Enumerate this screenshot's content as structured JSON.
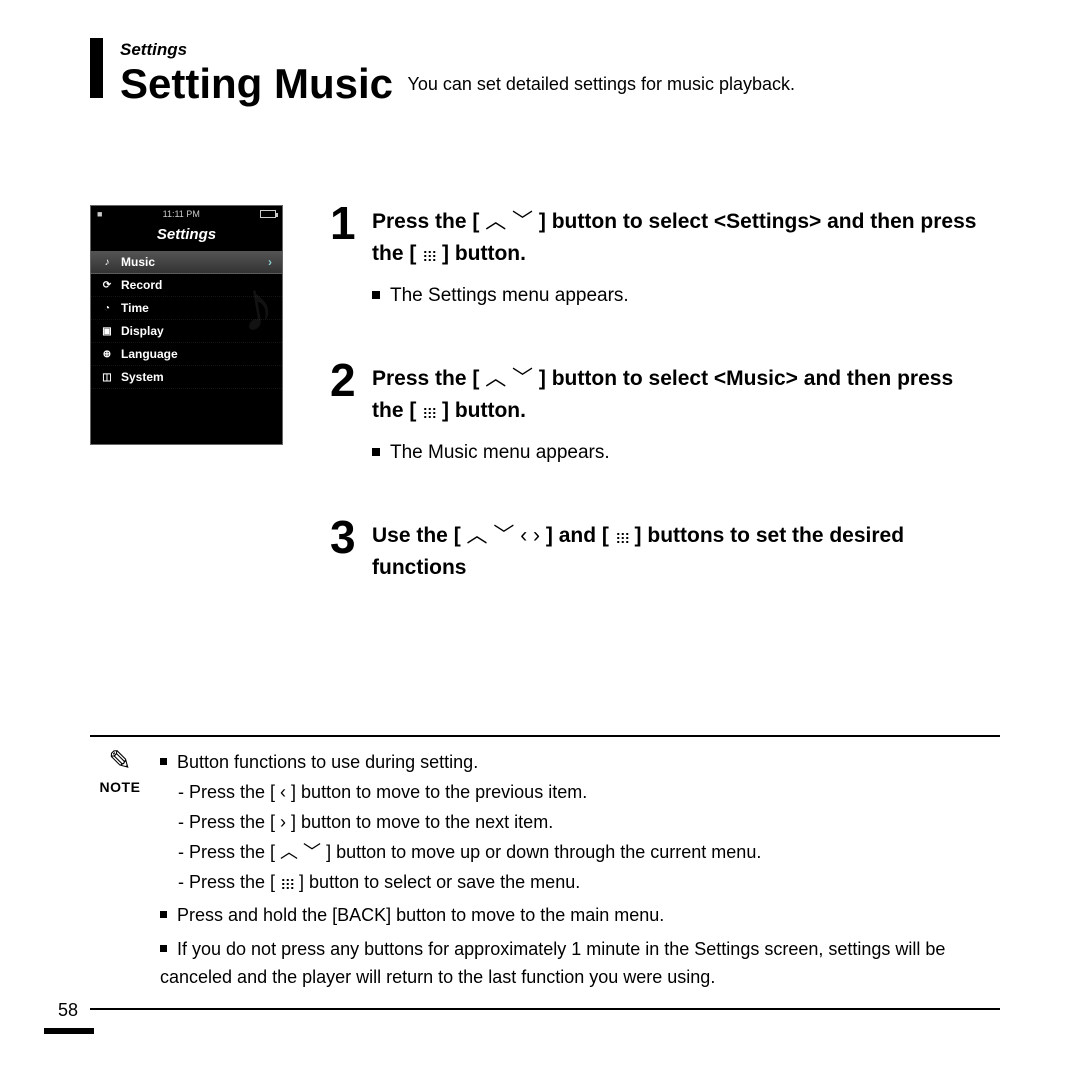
{
  "header": {
    "section_label": "Settings",
    "title": "Setting Music",
    "subtitle": "You can set detailed settings for music playback."
  },
  "device": {
    "time": "11:11 PM",
    "title": "Settings",
    "items": [
      {
        "icon": "♪",
        "label": "Music",
        "selected": true
      },
      {
        "icon": "⟳",
        "label": "Record",
        "selected": false
      },
      {
        "icon": "◔",
        "label": "Time",
        "selected": false
      },
      {
        "icon": "▣",
        "label": "Display",
        "selected": false
      },
      {
        "icon": "⊕",
        "label": "Language",
        "selected": false
      },
      {
        "icon": "◫",
        "label": "System",
        "selected": false
      }
    ]
  },
  "steps": [
    {
      "num": "1",
      "title_pre": "Press the [ ",
      "title_icons": "updown",
      "title_mid": " ] button to select <Settings> and then press the [ ",
      "title_icons2": "grid",
      "title_post": " ] button.",
      "sub": "The Settings menu appears."
    },
    {
      "num": "2",
      "title_pre": "Press the [ ",
      "title_icons": "updown",
      "title_mid": " ] button to select <Music> and then press the [ ",
      "title_icons2": "grid",
      "title_post": " ] button.",
      "sub": "The Music menu appears."
    },
    {
      "num": "3",
      "title_pre": "Use the [ ",
      "title_icons": "updownleftright",
      "title_mid": " ] and [ ",
      "title_icons2": "grid",
      "title_post": " ] buttons to set the desired functions",
      "sub": ""
    }
  ],
  "note": {
    "label": "NOTE",
    "line1": "Button functions to use during setting.",
    "sub1_pre": "- Press the [ ",
    "sub1_post": " ] button to move to the previous item.",
    "sub2_pre": "- Press the [ ",
    "sub2_post": " ] button to move to the next item.",
    "sub3_pre": "- Press the [ ",
    "sub3_post": " ] button to move up or down through the current menu.",
    "sub4_pre": "- Press the [ ",
    "sub4_post": " ] button to select or save the menu.",
    "line2": "Press and hold the [BACK] button to move to the main menu.",
    "line3": "If you do not press any buttons for approximately 1 minute in the Settings screen, settings will be canceled and the player will return to the last function you were using."
  },
  "page_number": "58",
  "icons": {
    "up": "❯",
    "down": "❯",
    "left": "❮",
    "right": "❯"
  }
}
